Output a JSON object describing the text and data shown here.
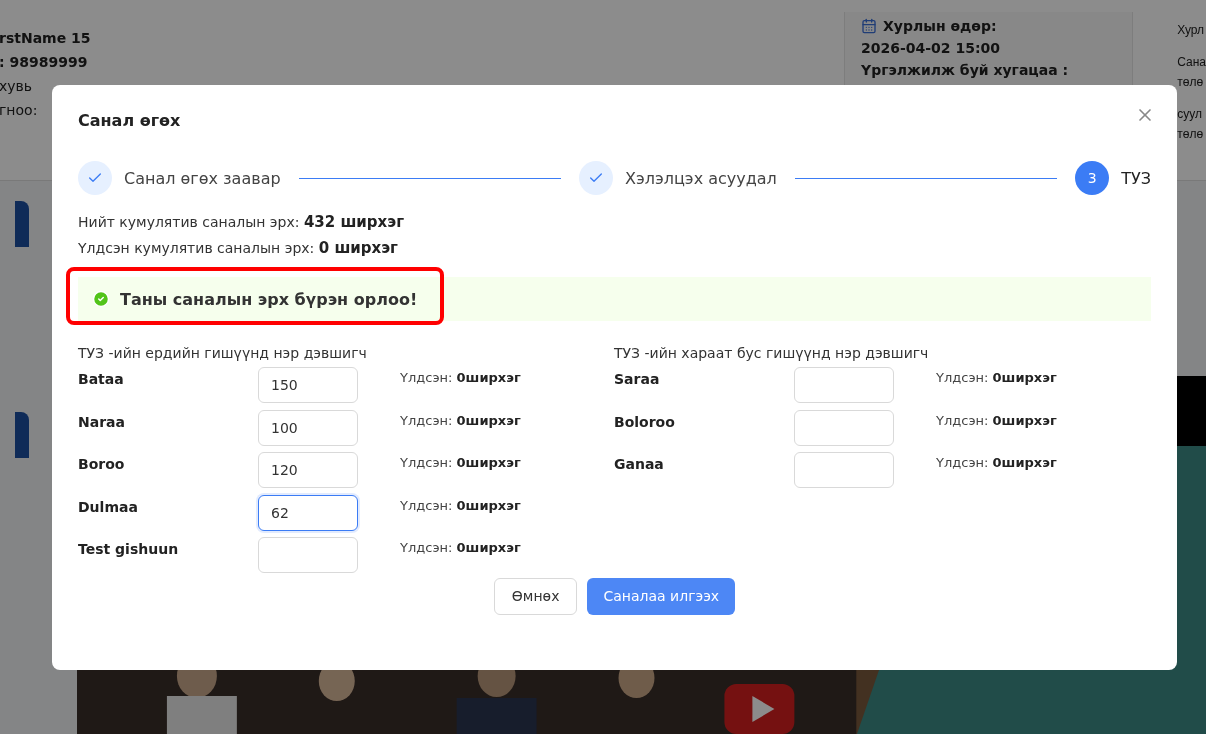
{
  "background": {
    "profile_lines": [
      {
        "text": "rstName 15",
        "bold": true
      },
      {
        "text": ": 98989999",
        "bold": true
      },
      {
        "text": "хувь",
        "bold": false
      },
      {
        "text": "гноо:",
        "bold": false
      }
    ],
    "meeting": {
      "date_label": "Хурлын өдөр:",
      "date": "2026-04-02 15:00",
      "duration_label": "Үргэлжилж буй хугацаа :"
    },
    "side_blocks": [
      [
        "Хурл"
      ],
      [
        "Сана",
        "төлө"
      ],
      [
        "суул",
        "төлө"
      ]
    ]
  },
  "dialog": {
    "title": "Санал өгөх",
    "steps": [
      {
        "label": "Санал өгөх заавар",
        "completed": true
      },
      {
        "label": "Хэлэлцэх асуудал",
        "completed": true
      },
      {
        "label": "ТУЗ",
        "number": "3",
        "completed": false
      }
    ],
    "totals": [
      "Нийт кумулятив саналын эрх: **432 ширхэг**",
      "Үлдсэн кумулятив саналын эрх: **0 ширхэг**"
    ],
    "alert": {
      "text": "Таны саналын эрх бүрэн орлоо!",
      "highlighted": true
    },
    "groups": [
      {
        "title": "ТУЗ -ийн ердийн гишүүнд нэр дэвшигч",
        "candidates": [
          {
            "name": "Bataa",
            "value": "150",
            "focused": false,
            "remaining": "Үлдсэн: **0ширхэг**"
          },
          {
            "name": "Naraa",
            "value": "100",
            "focused": false,
            "remaining": "Үлдсэн: **0ширхэг**"
          },
          {
            "name": "Boroo",
            "value": "120",
            "focused": false,
            "remaining": "Үлдсэн: **0ширхэг**"
          },
          {
            "name": "Dulmaa",
            "value": "62",
            "focused": true,
            "remaining": "Үлдсэн: **0ширхэг**"
          },
          {
            "name": "Test gishuun",
            "focused": false,
            "remaining": "Үлдсэн: **0ширхэг**"
          }
        ]
      },
      {
        "title": "ТУЗ -ийн хараат бус гишүүнд нэр дэвшигч",
        "candidates": [
          {
            "name": "Saraa",
            "focused": false,
            "remaining": "Үлдсэн: **0ширхэг**"
          },
          {
            "name": "Boloroo",
            "focused": false,
            "remaining": "Үлдсэн: **0ширхэг**"
          },
          {
            "name": "Ganaa",
            "focused": false,
            "remaining": "Үлдсэн: **0ширхэг**"
          }
        ]
      }
    ],
    "buttons": {
      "back": "Өмнөх",
      "submit": "Саналаа илгээх"
    }
  }
}
